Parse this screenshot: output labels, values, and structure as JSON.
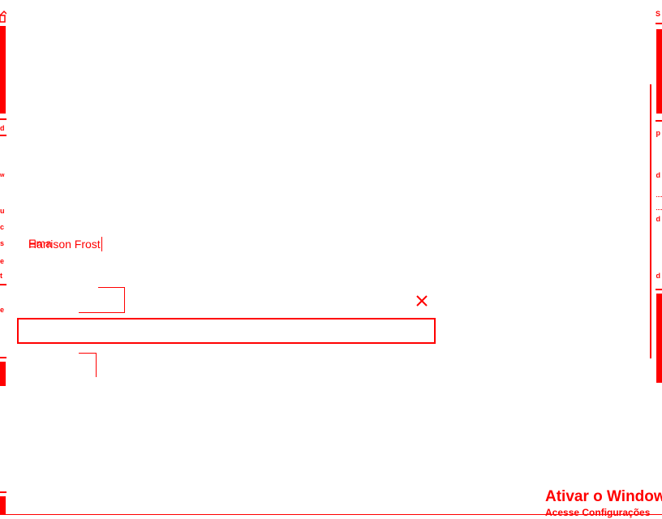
{
  "name_field": {
    "prefix_text": "Ema",
    "value": "Harrison Frost"
  },
  "text_input": {
    "value": "",
    "placeholder": ""
  },
  "close_icon": "close-icon",
  "right_panel": {
    "top_letter": "S",
    "mid_letter": "p"
  },
  "watermark": {
    "title": "Ativar o Windows",
    "subtitle": "Acesse Configurações"
  },
  "colors": {
    "accent": "#ff0000",
    "background": "#ffffff"
  }
}
